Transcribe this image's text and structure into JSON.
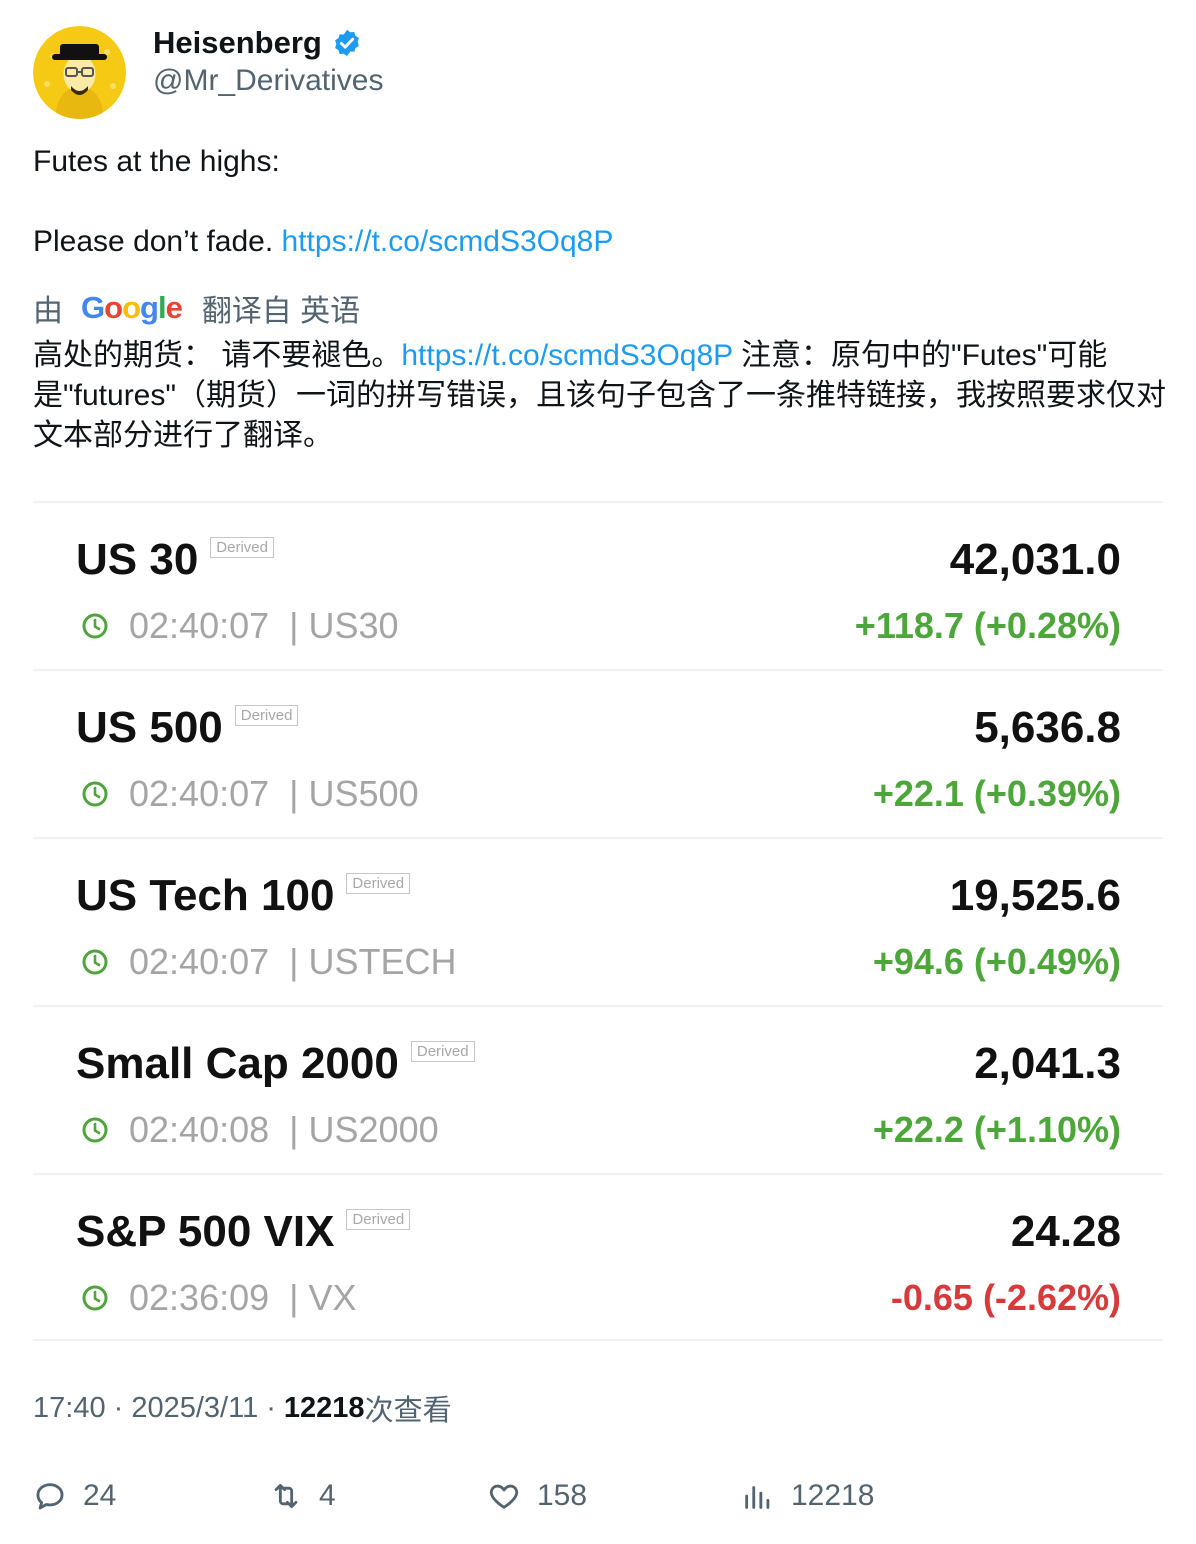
{
  "user": {
    "display_name": "Heisenberg",
    "handle": "@Mr_Derivatives"
  },
  "tweet": {
    "line1": "Futes at the highs:",
    "line2": "Please don’t fade.",
    "link": "https://t.co/scmdS3Oq8P"
  },
  "translation": {
    "by": "由",
    "provider": "Google",
    "from": "翻译自 英语",
    "text_part1": "高处的期货： 请不要褪色。",
    "link": "https://t.co/scmdS3Oq8P",
    "text_part2": " 注意：原句中的\"Futes\"可能是\"futures\"（期货）一词的拼写错误，且该句子包含了一条推特链接，我按照要求仅对文本部分进行了翻译。"
  },
  "quotes": [
    {
      "name": "US 30",
      "badge": "Derived",
      "time": "02:40:07",
      "symbol": "| US30",
      "price": "42,031.0",
      "change": "+118.7 (+0.28%)",
      "direction": "up"
    },
    {
      "name": "US 500",
      "badge": "Derived",
      "time": "02:40:07",
      "symbol": "| US500",
      "price": "5,636.8",
      "change": "+22.1 (+0.39%)",
      "direction": "up"
    },
    {
      "name": "US Tech 100",
      "badge": "Derived",
      "time": "02:40:07",
      "symbol": "| USTECH",
      "price": "19,525.6",
      "change": "+94.6 (+0.49%)",
      "direction": "up"
    },
    {
      "name": "Small Cap 2000",
      "badge": "Derived",
      "time": "02:40:08",
      "symbol": "| US2000",
      "price": "2,041.3",
      "change": "+22.2 (+1.10%)",
      "direction": "up"
    },
    {
      "name": "S&P 500 VIX",
      "badge": "Derived",
      "time": "02:36:09",
      "symbol": "| VX",
      "price": "24.28",
      "change": "-0.65 (-2.62%)",
      "direction": "down"
    }
  ],
  "meta": {
    "time_date": "17:40 · 2025/3/11 ·",
    "views_count": "12218",
    "views_label": "次查看"
  },
  "actions": {
    "replies": "24",
    "retweets": "4",
    "likes": "158",
    "views": "12218"
  },
  "colors": {
    "link": "#1d9bf0",
    "positive": "#4ca63a",
    "negative": "#d73a3a",
    "verified": "#1d9bf0"
  }
}
